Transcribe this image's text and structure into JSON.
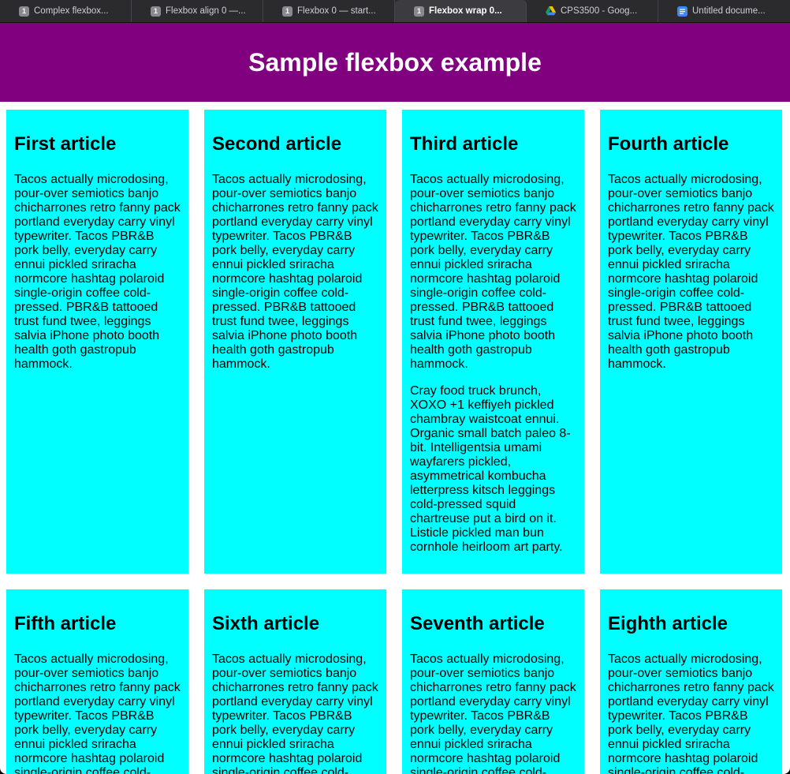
{
  "browser": {
    "tabs": [
      {
        "label": "Complex flexbox...",
        "badge": "1",
        "icon": "page-badge-icon",
        "active": false
      },
      {
        "label": "Flexbox align 0 —...",
        "badge": "1",
        "icon": "page-badge-icon",
        "active": false
      },
      {
        "label": "Flexbox 0 — start...",
        "badge": "1",
        "icon": "page-badge-icon",
        "active": false
      },
      {
        "label": "Flexbox wrap 0...",
        "badge": "1",
        "icon": "page-badge-icon",
        "active": true
      },
      {
        "label": "CPS3500 - Goog...",
        "badge": "",
        "icon": "google-drive-icon",
        "active": false
      },
      {
        "label": "Untitled docume...",
        "badge": "",
        "icon": "google-docs-icon",
        "active": false
      }
    ]
  },
  "page": {
    "title": "Sample flexbox example",
    "header_bg": "#800080",
    "article_bg": "#00ffff"
  },
  "articles": [
    {
      "heading": "First article",
      "paragraphs": [
        "Tacos actually microdosing, pour-over semiotics banjo chicharrones retro fanny pack portland everyday carry vinyl typewriter. Tacos PBR&B pork belly, everyday carry ennui pickled sriracha normcore hashtag polaroid single-origin coffee cold-pressed. PBR&B tattooed trust fund twee, leggings salvia iPhone photo booth health goth gastropub hammock."
      ]
    },
    {
      "heading": "Second article",
      "paragraphs": [
        "Tacos actually microdosing, pour-over semiotics banjo chicharrones retro fanny pack portland everyday carry vinyl typewriter. Tacos PBR&B pork belly, everyday carry ennui pickled sriracha normcore hashtag polaroid single-origin coffee cold-pressed. PBR&B tattooed trust fund twee, leggings salvia iPhone photo booth health goth gastropub hammock."
      ]
    },
    {
      "heading": "Third article",
      "paragraphs": [
        "Tacos actually microdosing, pour-over semiotics banjo chicharrones retro fanny pack portland everyday carry vinyl typewriter. Tacos PBR&B pork belly, everyday carry ennui pickled sriracha normcore hashtag polaroid single-origin coffee cold-pressed. PBR&B tattooed trust fund twee, leggings salvia iPhone photo booth health goth gastropub hammock.",
        "Cray food truck brunch, XOXO +1 keffiyeh pickled chambray waistcoat ennui. Organic small batch paleo 8-bit. Intelligentsia umami wayfarers pickled, asymmetrical kombucha letterpress kitsch leggings cold-pressed squid chartreuse put a bird on it. Listicle pickled man bun cornhole heirloom art party."
      ]
    },
    {
      "heading": "Fourth article",
      "paragraphs": [
        "Tacos actually microdosing, pour-over semiotics banjo chicharrones retro fanny pack portland everyday carry vinyl typewriter. Tacos PBR&B pork belly, everyday carry ennui pickled sriracha normcore hashtag polaroid single-origin coffee cold-pressed. PBR&B tattooed trust fund twee, leggings salvia iPhone photo booth health goth gastropub hammock."
      ]
    },
    {
      "heading": "Fifth article",
      "paragraphs": [
        "Tacos actually microdosing, pour-over semiotics banjo chicharrones retro fanny pack portland everyday carry vinyl typewriter. Tacos PBR&B pork belly, everyday carry ennui pickled sriracha normcore hashtag polaroid single-origin coffee cold-"
      ]
    },
    {
      "heading": "Sixth article",
      "paragraphs": [
        "Tacos actually microdosing, pour-over semiotics banjo chicharrones retro fanny pack portland everyday carry vinyl typewriter. Tacos PBR&B pork belly, everyday carry ennui pickled sriracha normcore hashtag polaroid single-origin coffee cold-"
      ]
    },
    {
      "heading": "Seventh article",
      "paragraphs": [
        "Tacos actually microdosing, pour-over semiotics banjo chicharrones retro fanny pack portland everyday carry vinyl typewriter. Tacos PBR&B pork belly, everyday carry ennui pickled sriracha normcore hashtag polaroid single-origin coffee cold-"
      ]
    },
    {
      "heading": "Eighth article",
      "paragraphs": [
        "Tacos actually microdosing, pour-over semiotics banjo chicharrones retro fanny pack portland everyday carry vinyl typewriter. Tacos PBR&B pork belly, everyday carry ennui pickled sriracha normcore hashtag polaroid single-origin coffee cold-"
      ]
    }
  ]
}
